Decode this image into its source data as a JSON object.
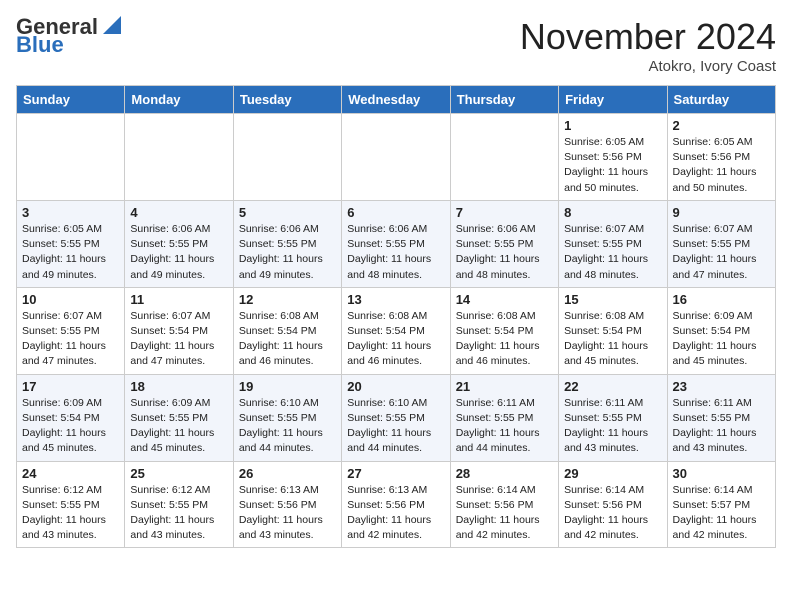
{
  "header": {
    "logo_general": "General",
    "logo_blue": "Blue",
    "month_title": "November 2024",
    "location": "Atokro, Ivory Coast"
  },
  "days_of_week": [
    "Sunday",
    "Monday",
    "Tuesday",
    "Wednesday",
    "Thursday",
    "Friday",
    "Saturday"
  ],
  "weeks": [
    [
      {
        "day": "",
        "info": ""
      },
      {
        "day": "",
        "info": ""
      },
      {
        "day": "",
        "info": ""
      },
      {
        "day": "",
        "info": ""
      },
      {
        "day": "",
        "info": ""
      },
      {
        "day": "1",
        "info": "Sunrise: 6:05 AM\nSunset: 5:56 PM\nDaylight: 11 hours\nand 50 minutes."
      },
      {
        "day": "2",
        "info": "Sunrise: 6:05 AM\nSunset: 5:56 PM\nDaylight: 11 hours\nand 50 minutes."
      }
    ],
    [
      {
        "day": "3",
        "info": "Sunrise: 6:05 AM\nSunset: 5:55 PM\nDaylight: 11 hours\nand 49 minutes."
      },
      {
        "day": "4",
        "info": "Sunrise: 6:06 AM\nSunset: 5:55 PM\nDaylight: 11 hours\nand 49 minutes."
      },
      {
        "day": "5",
        "info": "Sunrise: 6:06 AM\nSunset: 5:55 PM\nDaylight: 11 hours\nand 49 minutes."
      },
      {
        "day": "6",
        "info": "Sunrise: 6:06 AM\nSunset: 5:55 PM\nDaylight: 11 hours\nand 48 minutes."
      },
      {
        "day": "7",
        "info": "Sunrise: 6:06 AM\nSunset: 5:55 PM\nDaylight: 11 hours\nand 48 minutes."
      },
      {
        "day": "8",
        "info": "Sunrise: 6:07 AM\nSunset: 5:55 PM\nDaylight: 11 hours\nand 48 minutes."
      },
      {
        "day": "9",
        "info": "Sunrise: 6:07 AM\nSunset: 5:55 PM\nDaylight: 11 hours\nand 47 minutes."
      }
    ],
    [
      {
        "day": "10",
        "info": "Sunrise: 6:07 AM\nSunset: 5:55 PM\nDaylight: 11 hours\nand 47 minutes."
      },
      {
        "day": "11",
        "info": "Sunrise: 6:07 AM\nSunset: 5:54 PM\nDaylight: 11 hours\nand 47 minutes."
      },
      {
        "day": "12",
        "info": "Sunrise: 6:08 AM\nSunset: 5:54 PM\nDaylight: 11 hours\nand 46 minutes."
      },
      {
        "day": "13",
        "info": "Sunrise: 6:08 AM\nSunset: 5:54 PM\nDaylight: 11 hours\nand 46 minutes."
      },
      {
        "day": "14",
        "info": "Sunrise: 6:08 AM\nSunset: 5:54 PM\nDaylight: 11 hours\nand 46 minutes."
      },
      {
        "day": "15",
        "info": "Sunrise: 6:08 AM\nSunset: 5:54 PM\nDaylight: 11 hours\nand 45 minutes."
      },
      {
        "day": "16",
        "info": "Sunrise: 6:09 AM\nSunset: 5:54 PM\nDaylight: 11 hours\nand 45 minutes."
      }
    ],
    [
      {
        "day": "17",
        "info": "Sunrise: 6:09 AM\nSunset: 5:54 PM\nDaylight: 11 hours\nand 45 minutes."
      },
      {
        "day": "18",
        "info": "Sunrise: 6:09 AM\nSunset: 5:55 PM\nDaylight: 11 hours\nand 45 minutes."
      },
      {
        "day": "19",
        "info": "Sunrise: 6:10 AM\nSunset: 5:55 PM\nDaylight: 11 hours\nand 44 minutes."
      },
      {
        "day": "20",
        "info": "Sunrise: 6:10 AM\nSunset: 5:55 PM\nDaylight: 11 hours\nand 44 minutes."
      },
      {
        "day": "21",
        "info": "Sunrise: 6:11 AM\nSunset: 5:55 PM\nDaylight: 11 hours\nand 44 minutes."
      },
      {
        "day": "22",
        "info": "Sunrise: 6:11 AM\nSunset: 5:55 PM\nDaylight: 11 hours\nand 43 minutes."
      },
      {
        "day": "23",
        "info": "Sunrise: 6:11 AM\nSunset: 5:55 PM\nDaylight: 11 hours\nand 43 minutes."
      }
    ],
    [
      {
        "day": "24",
        "info": "Sunrise: 6:12 AM\nSunset: 5:55 PM\nDaylight: 11 hours\nand 43 minutes."
      },
      {
        "day": "25",
        "info": "Sunrise: 6:12 AM\nSunset: 5:55 PM\nDaylight: 11 hours\nand 43 minutes."
      },
      {
        "day": "26",
        "info": "Sunrise: 6:13 AM\nSunset: 5:56 PM\nDaylight: 11 hours\nand 43 minutes."
      },
      {
        "day": "27",
        "info": "Sunrise: 6:13 AM\nSunset: 5:56 PM\nDaylight: 11 hours\nand 42 minutes."
      },
      {
        "day": "28",
        "info": "Sunrise: 6:14 AM\nSunset: 5:56 PM\nDaylight: 11 hours\nand 42 minutes."
      },
      {
        "day": "29",
        "info": "Sunrise: 6:14 AM\nSunset: 5:56 PM\nDaylight: 11 hours\nand 42 minutes."
      },
      {
        "day": "30",
        "info": "Sunrise: 6:14 AM\nSunset: 5:57 PM\nDaylight: 11 hours\nand 42 minutes."
      }
    ]
  ]
}
